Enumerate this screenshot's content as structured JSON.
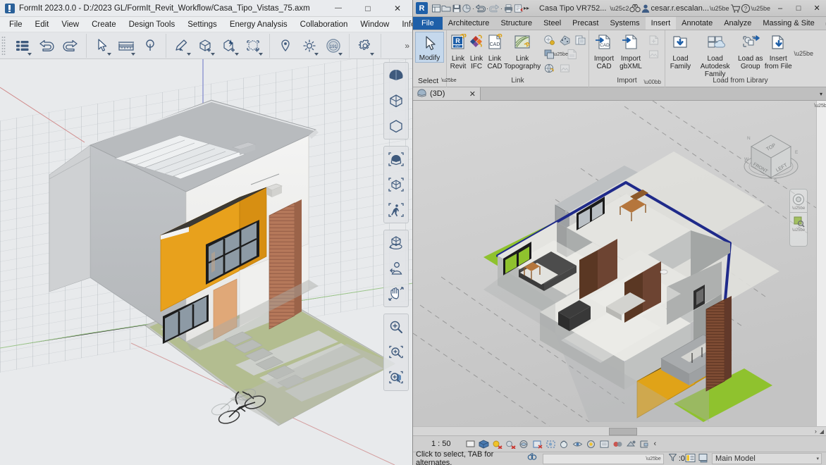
{
  "formit": {
    "title": "FormIt 2023.0.0 - D:/2023 GL/FormIt_Revit_Workflow/Casa_Tipo_Vistas_75.axm",
    "app_icon": "formit-logo-icon",
    "window_buttons": [
      {
        "name": "minimize",
        "glyph": "—"
      },
      {
        "name": "maximize",
        "glyph": "□"
      },
      {
        "name": "close",
        "glyph": "✕"
      }
    ],
    "menus": [
      "File",
      "Edit",
      "View",
      "Create",
      "Design Tools",
      "Settings",
      "Energy Analysis",
      "Collaboration",
      "Window",
      "Info"
    ],
    "toolbar_groups": [
      {
        "name": "history",
        "buttons": [
          {
            "name": "layers-icon",
            "caret": true
          },
          {
            "name": "undo-icon",
            "caret": false
          },
          {
            "name": "redo-icon",
            "caret": false
          }
        ]
      },
      {
        "name": "select-measure",
        "buttons": [
          {
            "name": "select-cursor-icon",
            "caret": true
          },
          {
            "name": "tape-measure-icon",
            "caret": true
          },
          {
            "name": "protractor-icon",
            "caret": false
          }
        ]
      },
      {
        "name": "create",
        "buttons": [
          {
            "name": "sketch-pencil-icon",
            "caret": true
          },
          {
            "name": "add-solid-icon",
            "caret": true
          },
          {
            "name": "quick-solid-icon",
            "caret": true
          },
          {
            "name": "group-add-icon",
            "caret": true
          }
        ]
      },
      {
        "name": "context",
        "buttons": [
          {
            "name": "location-pin-icon",
            "caret": false
          },
          {
            "name": "sun-shadow-icon",
            "caret": true
          },
          {
            "name": "solar-analysis-icon",
            "caret": true,
            "badge": "191"
          }
        ]
      },
      {
        "name": "settings",
        "buttons": [
          {
            "name": "gear-icon",
            "caret": true
          }
        ]
      }
    ],
    "toolbar_overflow": "»",
    "view_toolbar": [
      {
        "group": "visual-style",
        "buttons": [
          "shaded-style-icon",
          "hidden-line-style-icon",
          "wireframe-style-icon"
        ]
      },
      {
        "group": "camera",
        "buttons": [
          "zoom-selection-icon",
          "zoom-extents-icon",
          "walkthrough-icon"
        ]
      },
      {
        "group": "navigate",
        "buttons": [
          "orbit-icon",
          "look-around-icon",
          "pan-hand-icon"
        ]
      },
      {
        "group": "zoom",
        "buttons": [
          "zoom-in-icon",
          "zoom-window-icon",
          "zoom-object-icon"
        ]
      }
    ],
    "canvas": {
      "name": "formit-3d-viewport",
      "axis_colors": {
        "x": "#cf6b6b",
        "y": "#7bbf5e",
        "z": "#6f76c6"
      },
      "model_colors": {
        "wall": "#f0f0f0",
        "wall_shade": "#b9bcbf",
        "roof": "#b8bbbe",
        "accent_orange": "#e8a11c",
        "wood_slats": "#b5785a",
        "door": "#e0a878",
        "glass": "#8d9aa5",
        "lawn": "#b3bd90",
        "paver": "#c8cbc7"
      }
    }
  },
  "revit": {
    "quick_access": {
      "logo": "R",
      "buttons": [
        {
          "name": "new-icon"
        },
        {
          "name": "open-icon"
        },
        {
          "name": "save-icon"
        },
        {
          "name": "sync-icon"
        },
        {
          "name": "undo-icon"
        },
        {
          "name": "redo-icon"
        },
        {
          "name": "print-icon"
        },
        {
          "name": "measure-icon"
        },
        {
          "name": "customize-qat-icon",
          "glyph": "▸▸"
        }
      ],
      "doc_name": "Casa Tipo VR752...",
      "search_icon": "binoculars-icon",
      "user_icon": "user-account-icon",
      "user_name": "cesar.r.escalan...",
      "cart_icon": "autodesk-store-icon",
      "help_icon": "help-icon"
    },
    "window_buttons": [
      {
        "name": "minimize",
        "glyph": "–"
      },
      {
        "name": "maximize",
        "glyph": "□"
      },
      {
        "name": "close",
        "glyph": "✕"
      }
    ],
    "ribbon_tabs": [
      {
        "label": "File",
        "state": "file"
      },
      {
        "label": "Architecture",
        "state": "normal"
      },
      {
        "label": "Structure",
        "state": "normal"
      },
      {
        "label": "Steel",
        "state": "normal"
      },
      {
        "label": "Precast",
        "state": "normal"
      },
      {
        "label": "Systems",
        "state": "normal"
      },
      {
        "label": "Insert",
        "state": "active"
      },
      {
        "label": "Annotate",
        "state": "normal"
      },
      {
        "label": "Analyze",
        "state": "normal"
      },
      {
        "label": "Massing & Site",
        "state": "normal"
      }
    ],
    "ribbon_overflow": "▸▸",
    "ribbon_display_icon": "ribbon-display-options-icon",
    "panels": [
      {
        "title": "Select",
        "name": "panel-select",
        "dropdown": true,
        "items": [
          {
            "name": "modify-button",
            "label": "Modify",
            "icon": "arrow-cursor-icon",
            "selected": true
          }
        ]
      },
      {
        "title": "Link",
        "name": "panel-link",
        "items": [
          {
            "name": "link-revit-button",
            "label": "Link\nRevit",
            "icon": "link-revit-icon"
          },
          {
            "name": "link-ifc-button",
            "label": "Link\nIFC",
            "icon": "link-ifc-icon"
          },
          {
            "name": "link-cad-button",
            "label": "Link\nCAD",
            "icon": "link-cad-icon"
          },
          {
            "name": "link-topography-button",
            "label": "Link\nTopography",
            "icon": "link-topography-icon"
          }
        ],
        "small_items": [
          {
            "name": "dwf-markup-button",
            "icon": "dwf-markup-icon"
          },
          {
            "name": "decal-button",
            "icon": "decal-icon"
          },
          {
            "name": "point-cloud-button",
            "icon": "point-cloud-icon"
          },
          {
            "name": "coordination-model-button",
            "icon": "coordination-model-icon"
          },
          {
            "name": "pdf-link-button",
            "icon": "pdf-link-icon"
          },
          {
            "name": "image-link-button",
            "icon": "image-link-icon"
          },
          {
            "name": "manage-links-button",
            "icon": "manage-links-icon"
          }
        ]
      },
      {
        "title": "Import",
        "name": "panel-import",
        "dialog_launcher": true,
        "items": [
          {
            "name": "import-cad-button",
            "label": "Import\nCAD",
            "icon": "import-cad-icon"
          },
          {
            "name": "import-gbxml-button",
            "label": "Import\ngbXML",
            "icon": "import-gbxml-icon"
          }
        ],
        "small_items": [
          {
            "name": "insert-from-file-small-button",
            "icon": "insert-file-icon"
          },
          {
            "name": "image-import-button",
            "icon": "image-import-icon"
          }
        ]
      },
      {
        "title": "Load from Library",
        "name": "panel-load-from-library",
        "items": [
          {
            "name": "load-family-button",
            "label": "Load\nFamily",
            "icon": "load-family-icon"
          },
          {
            "name": "load-autodesk-family-button",
            "label": "Load Autodesk\nFamily",
            "icon": "load-autodesk-family-icon"
          },
          {
            "name": "load-as-group-button",
            "label": "Load as\nGroup",
            "icon": "load-as-group-icon"
          },
          {
            "name": "insert-from-file-button",
            "label": "Insert\nfrom File",
            "icon": "insert-from-file-icon"
          }
        ]
      }
    ],
    "view_tab": {
      "label": "(3D)",
      "icon": "3d-view-icon",
      "close_glyph": "✕",
      "collapse_glyph": "▾"
    },
    "canvas": {
      "name": "revit-3d-viewport",
      "section_box_color": "#1f2a8a",
      "model_colors": {
        "wall": "#9ea1a3",
        "floor": "#e0e0dc",
        "partition": "#b8bab9",
        "wood_door": "#6d4432",
        "accent_orange": "#e0a318",
        "lawn": "#8fc22e",
        "wood_slats": "#7d4b33"
      }
    },
    "viewcube": {
      "name": "view-cube",
      "faces": [
        "TOP",
        "FRONT",
        "LEFT"
      ],
      "compass": [
        "N",
        "E",
        "S",
        "W"
      ]
    },
    "navbar": {
      "name": "navigation-bar",
      "buttons": [
        "steering-wheel-icon",
        "zoom-region-icon"
      ]
    },
    "view_control_bar": {
      "scale": "1 : 50",
      "buttons": [
        {
          "name": "scale-button"
        },
        {
          "name": "detail-level-icon"
        },
        {
          "name": "visual-style-icon"
        },
        {
          "name": "sun-path-icon"
        },
        {
          "name": "shadows-icon"
        },
        {
          "name": "render-dialog-icon"
        },
        {
          "name": "crop-view-icon"
        },
        {
          "name": "show-crop-region-icon"
        },
        {
          "name": "lock-3d-view-icon"
        },
        {
          "name": "temporary-hide-isolate-icon"
        },
        {
          "name": "reveal-hidden-elements-icon"
        },
        {
          "name": "temporary-view-properties-icon"
        },
        {
          "name": "show-analytical-model-icon"
        },
        {
          "name": "highlight-displacement-sets-icon"
        },
        {
          "name": "constraints-icon"
        }
      ],
      "overflow_glyph": "‹"
    },
    "status_bar": {
      "text": "Click to select, TAB for alternates,",
      "tab_icon": "select-alternates-icon",
      "filter_combo_value": "",
      "selection_icon": "filter-icon",
      "selection_count": ":0",
      "right_buttons": [
        {
          "name": "properties-toggle-icon"
        },
        {
          "name": "worksets-icon"
        }
      ],
      "design_option": "Main Model",
      "combo_arrow": "▾"
    },
    "scrollbar": {
      "name": "horizontal-scrollbar",
      "expand_glyph": "›",
      "resize_glyph": "◢"
    }
  }
}
